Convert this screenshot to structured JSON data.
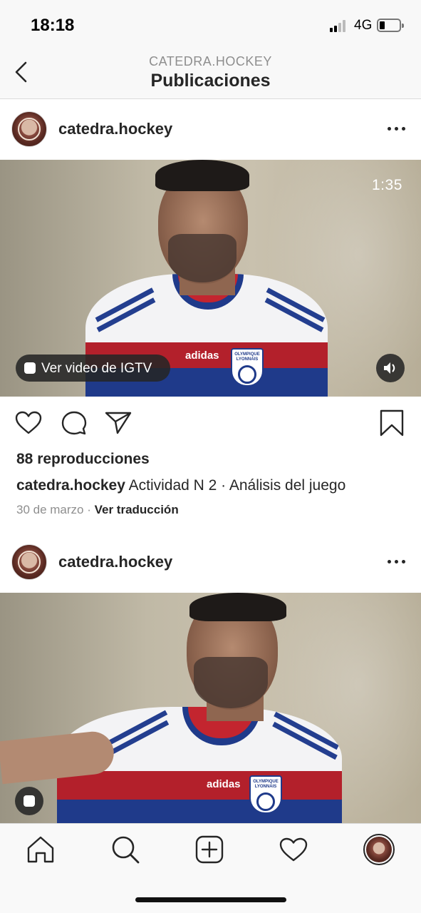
{
  "status_bar": {
    "time": "18:18",
    "network": "4G"
  },
  "header": {
    "subtitle": "CATEDRA.HOCKEY",
    "title": "Publicaciones"
  },
  "posts": [
    {
      "username": "catedra.hockey",
      "duration": "1:35",
      "igtv_label": "Ver video de IGTV",
      "views": "88 reproducciones",
      "caption_user": "catedra.hockey",
      "caption_text": "Actividad N 2 · Análisis del juego",
      "date": "30 de marzo",
      "separator": " · ",
      "translate": "Ver traducción",
      "jersey_brand": "adidas",
      "crest_text": "OLYMPIQUE LYONNAIS"
    },
    {
      "username": "catedra.hockey",
      "jersey_brand": "adidas",
      "crest_text": "OLYMPIQUE LYONNAIS"
    }
  ],
  "icons": {
    "back": "chevron-left-icon",
    "more": "more-horizontal-icon",
    "like": "heart-icon",
    "comment": "comment-icon",
    "share": "paper-plane-icon",
    "save": "bookmark-icon",
    "igtv": "igtv-icon",
    "sound": "speaker-icon",
    "home": "home-icon",
    "search": "search-icon",
    "new_post": "plus-square-icon",
    "activity": "heart-icon",
    "profile": "profile-avatar"
  }
}
